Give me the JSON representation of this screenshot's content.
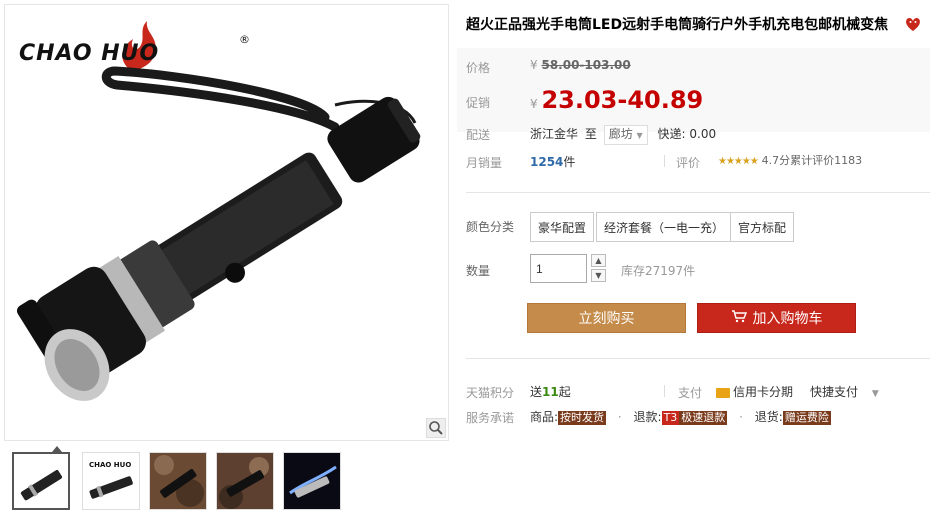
{
  "brand": {
    "logo_text": "CHAO HUO",
    "registered": "®"
  },
  "product": {
    "title": "超火正品强光手电筒LED远射手电筒骑行户外手机充电包邮机械变焦"
  },
  "price": {
    "label": "价格",
    "currency": "¥",
    "original": "58.00-103.00"
  },
  "promo": {
    "label": "促销",
    "currency": "¥",
    "price": "23.03-40.89"
  },
  "shipping": {
    "label": "配送",
    "from": "浙江金华",
    "to_word": "至",
    "destination": "廊坊",
    "fee": "快递: 0.00"
  },
  "sales": {
    "label": "月销量",
    "count": "1254",
    "unit": "件",
    "rating_label": "评价",
    "score": "4.7分",
    "reviews": "累计评价1183"
  },
  "sku": {
    "label": "颜色分类",
    "options": [
      "豪华配置",
      "经济套餐（一电一充）",
      "官方标配"
    ]
  },
  "quantity": {
    "label": "数量",
    "value": "1",
    "stock": "库存27197件"
  },
  "actions": {
    "buy_now": "立刻购买",
    "add_cart": "加入购物车"
  },
  "points": {
    "label": "天猫积分",
    "text_prefix": "送",
    "value": "11",
    "text_suffix": "起",
    "pay_label": "支付",
    "credit": "信用卡分期",
    "quick_pay": "快捷支付"
  },
  "service": {
    "label": "服务承诺",
    "goods_label": "商品:",
    "goods_badge": "按时发货",
    "refund_label": "退款:",
    "refund_badge_1": "T3",
    "refund_badge_2": "极速退款",
    "return_label": "退货:",
    "return_badge": "赠运费险"
  },
  "colors": {
    "promo": "#c40000",
    "buy_btn": "#c58b4a",
    "cart_btn": "#c8281c",
    "sales_blue": "#2f6aa7",
    "points_green": "#3b8a0f",
    "logo_red": "#c8281c"
  }
}
